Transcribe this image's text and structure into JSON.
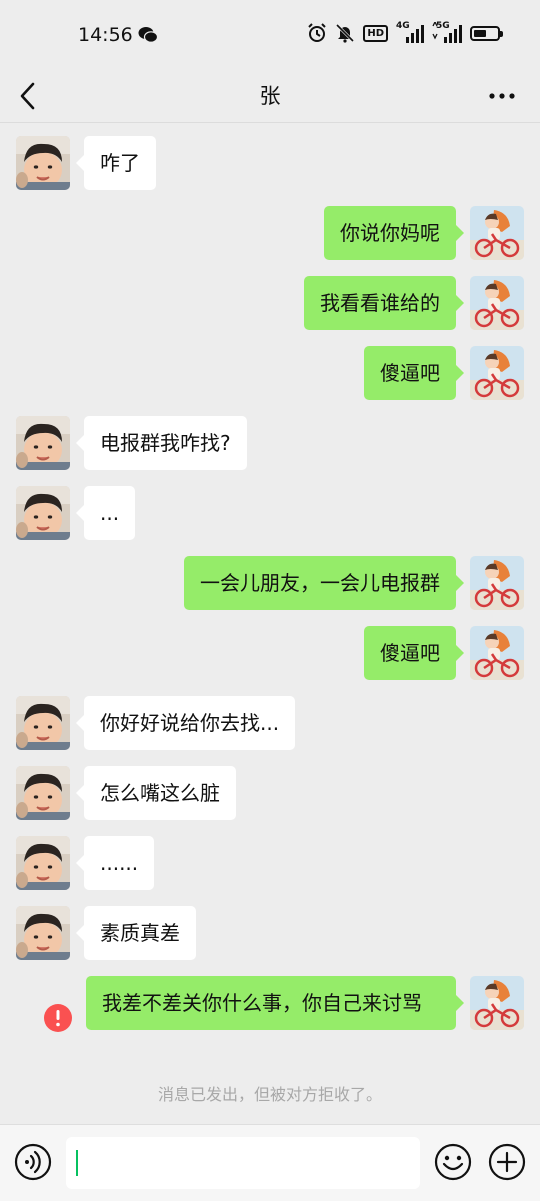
{
  "status_bar": {
    "time": "14:56",
    "network_1": "4G",
    "network_2": "5G",
    "hd_label": "HD"
  },
  "nav": {
    "title": "张"
  },
  "messages": [
    {
      "side": "left",
      "text": "咋了"
    },
    {
      "side": "right",
      "text": "你说你妈呢"
    },
    {
      "side": "right",
      "text": "我看看谁给的"
    },
    {
      "side": "right",
      "text": "傻逼吧"
    },
    {
      "side": "left",
      "text": "电报群我咋找?"
    },
    {
      "side": "left",
      "text": "..."
    },
    {
      "side": "right",
      "text": "一会儿朋友，一会儿电报群"
    },
    {
      "side": "right",
      "text": "傻逼吧"
    },
    {
      "side": "left",
      "text": "你好好说给你去找..."
    },
    {
      "side": "left",
      "text": "怎么嘴这么脏"
    },
    {
      "side": "left",
      "text": "......"
    },
    {
      "side": "left",
      "text": "素质真差"
    },
    {
      "side": "right",
      "text": "我差不差关你什么事，你自己来讨骂",
      "failed": true
    }
  ],
  "system_notice": "消息已发出，但被对方拒收了。",
  "input": {
    "value": ""
  },
  "colors": {
    "background": "#ededed",
    "sent_bubble": "#95ec69",
    "received_bubble": "#ffffff",
    "error": "#fa5151",
    "caret": "#07c160"
  },
  "icons": {
    "back": "chevron-left-icon",
    "more": "more-dots-icon",
    "voice": "voice-icon",
    "emoji": "emoji-icon",
    "add": "plus-circle-icon",
    "failed": "exclamation-circle-icon"
  }
}
